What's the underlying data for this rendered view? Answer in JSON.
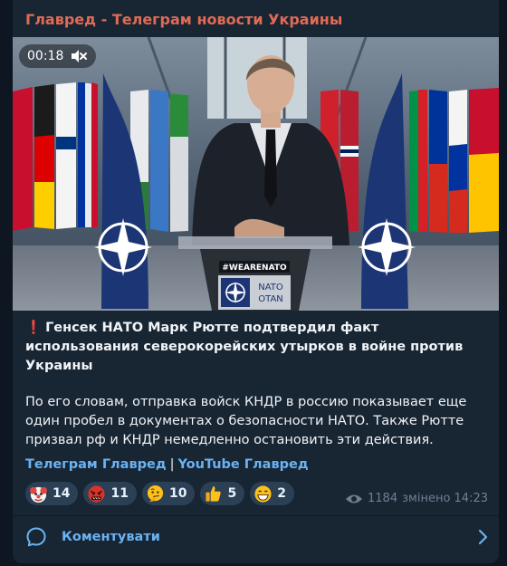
{
  "post": {
    "channel_name": "Главред - Телеграм новости Украины",
    "video": {
      "duration": "00:18",
      "muted": true,
      "sign_text": "#WEARENATO",
      "podium_logo_line1": "NATO",
      "podium_logo_line2": "OTAN"
    },
    "headline_mark": "❗",
    "headline": "Генсек НАТО Марк Рютте подтвердил факт использования северокорейских утырков в войне против Украины",
    "paragraph": "По его словам, отправка войск КНДР в россию показывает еще один пробел в документах о безопасности НАТО. Также Рютте призвал рф и КНДР немедленно остановить эти действия.",
    "links": {
      "telegram": "Телеграм Главред",
      "separator": "|",
      "youtube": "YouTube Главред"
    },
    "reactions": [
      {
        "emoji": "clown-face",
        "count": "14"
      },
      {
        "emoji": "angry-face-with-symbols",
        "count": "11"
      },
      {
        "emoji": "thinking-face",
        "count": "10"
      },
      {
        "emoji": "thumbs-up",
        "count": "5"
      },
      {
        "emoji": "grinning-face",
        "count": "2"
      }
    ],
    "views": "1184",
    "edited_time": "змінено 14:23",
    "comments_label": "Коментувати"
  },
  "colors": {
    "background": "#0e1621",
    "card": "#182533",
    "channel_name": "#e06b55",
    "link": "#6ab3f3",
    "reaction_bg": "#2b3f55",
    "meta": "#6d8092"
  }
}
